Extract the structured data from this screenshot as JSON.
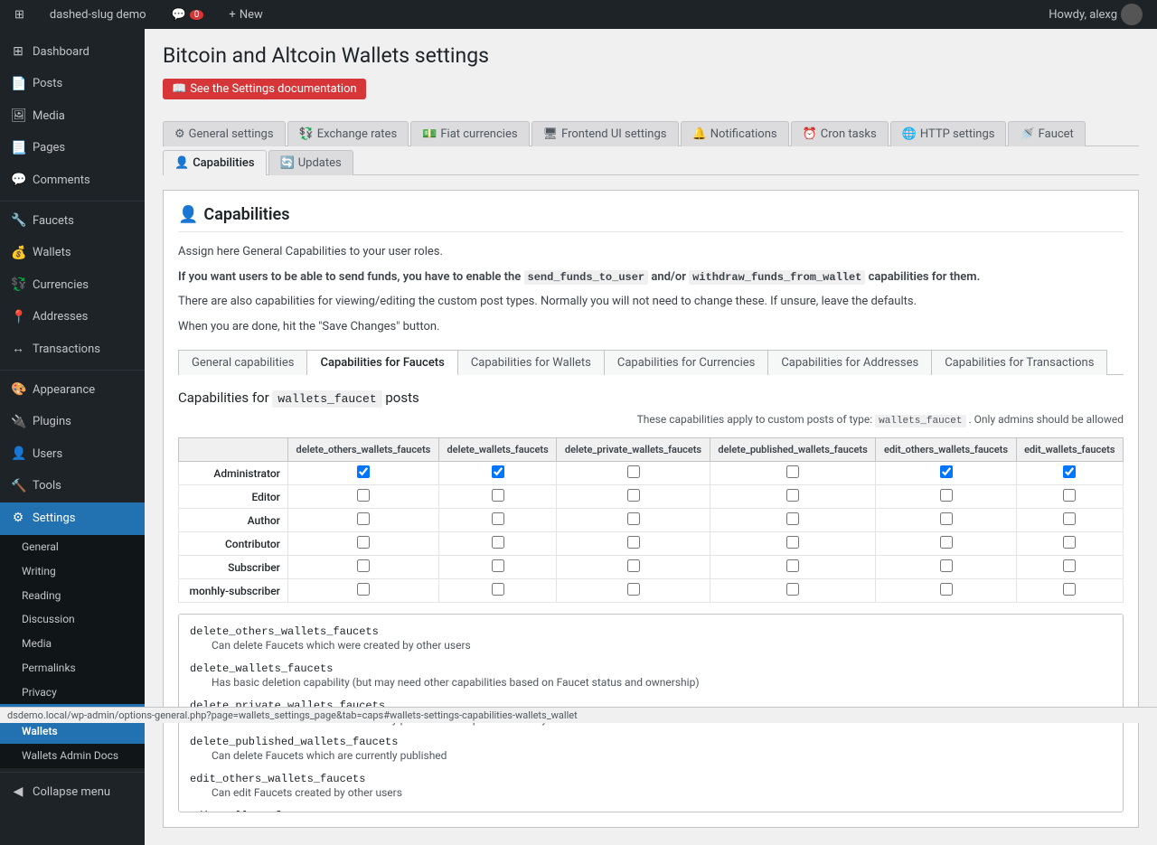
{
  "adminbar": {
    "logo": "⊞",
    "site_name": "dashed-slug demo",
    "comments_label": "Comments",
    "comments_count": "0",
    "new_label": "New",
    "howdy": "Howdy, alexg"
  },
  "page": {
    "title": "Bitcoin and Altcoin Wallets settings",
    "doc_btn": "See the Settings documentation"
  },
  "sidebar": {
    "items": [
      {
        "id": "dashboard",
        "icon": "⊞",
        "label": "Dashboard"
      },
      {
        "id": "posts",
        "icon": "📄",
        "label": "Posts"
      },
      {
        "id": "media",
        "icon": "🖼",
        "label": "Media"
      },
      {
        "id": "pages",
        "icon": "📃",
        "label": "Pages"
      },
      {
        "id": "comments",
        "icon": "💬",
        "label": "Comments"
      },
      {
        "id": "faucets",
        "icon": "🔧",
        "label": "Faucets"
      },
      {
        "id": "wallets",
        "icon": "💰",
        "label": "Wallets"
      },
      {
        "id": "currencies",
        "icon": "💱",
        "label": "Currencies"
      },
      {
        "id": "addresses",
        "icon": "📍",
        "label": "Addresses"
      },
      {
        "id": "transactions",
        "icon": "↔",
        "label": "Transactions"
      },
      {
        "id": "appearance",
        "icon": "🎨",
        "label": "Appearance"
      },
      {
        "id": "plugins",
        "icon": "🔌",
        "label": "Plugins"
      },
      {
        "id": "users",
        "icon": "👤",
        "label": "Users"
      },
      {
        "id": "tools",
        "icon": "🔨",
        "label": "Tools"
      },
      {
        "id": "settings",
        "icon": "⚙",
        "label": "Settings",
        "active": true
      }
    ],
    "submenu": [
      {
        "id": "general",
        "label": "General"
      },
      {
        "id": "writing",
        "label": "Writing"
      },
      {
        "id": "reading",
        "label": "Reading"
      },
      {
        "id": "discussion",
        "label": "Discussion"
      },
      {
        "id": "media",
        "label": "Media"
      },
      {
        "id": "permalinks",
        "label": "Permalinks"
      },
      {
        "id": "privacy",
        "label": "Privacy"
      },
      {
        "id": "bitcoin-altcoin",
        "label": "Bitcoin & Altcoin Wallets",
        "active": true
      },
      {
        "id": "wallets-admin-docs",
        "label": "Wallets Admin Docs"
      }
    ],
    "collapse": "Collapse menu"
  },
  "main_tabs": [
    {
      "id": "general-settings",
      "icon": "⚙",
      "label": "General settings"
    },
    {
      "id": "exchange-rates",
      "icon": "💱",
      "label": "Exchange rates",
      "active": false
    },
    {
      "id": "fiat-currencies",
      "icon": "💵",
      "label": "Fiat currencies"
    },
    {
      "id": "frontend-ui",
      "icon": "🖥",
      "label": "Frontend UI settings"
    },
    {
      "id": "notifications",
      "icon": "🔔",
      "label": "Notifications"
    },
    {
      "id": "cron-tasks",
      "icon": "⏰",
      "label": "Cron tasks"
    },
    {
      "id": "http-settings",
      "icon": "🌐",
      "label": "HTTP settings"
    },
    {
      "id": "faucet",
      "icon": "🚿",
      "label": "Faucet"
    }
  ],
  "second_tabs": [
    {
      "id": "capabilities",
      "label": "Capabilities",
      "icon": "👤",
      "active": true
    },
    {
      "id": "updates",
      "label": "Updates",
      "icon": "🔄"
    }
  ],
  "section": {
    "title": "Capabilities",
    "icon": "👤",
    "description1": "Assign here General Capabilities to your user roles.",
    "description2_pre": "If you want users to be able to send funds, you have to enable the ",
    "description2_code1": "send_funds_to_user",
    "description2_mid": " and/or ",
    "description2_code2": "withdraw_funds_from_wallet",
    "description2_post": " capabilities for them.",
    "description3": "There are also capabilities for viewing/editing the custom post types. Normally you will not need to change these. If unsure, leave the defaults.",
    "description4": "When you are done, hit the \"Save Changes\" button."
  },
  "inner_tabs": [
    {
      "id": "general-caps",
      "label": "General capabilities"
    },
    {
      "id": "caps-faucets",
      "label": "Capabilities for Faucets",
      "active": true
    },
    {
      "id": "caps-wallets",
      "label": "Capabilities for Wallets"
    },
    {
      "id": "caps-currencies",
      "label": "Capabilities for Currencies"
    },
    {
      "id": "caps-addresses",
      "label": "Capabilities for Addresses"
    },
    {
      "id": "caps-transactions",
      "label": "Capabilities for Transactions"
    }
  ],
  "caps_for": {
    "label": "Capabilities for",
    "post_type": "wallets_faucet",
    "posts_label": "posts",
    "note_pre": "These capabilities apply to custom posts of type:",
    "note_code": "wallets_faucet",
    "note_post": ". Only admins should be allowed"
  },
  "table": {
    "columns": [
      "delete_others_wallets_faucets",
      "delete_wallets_faucets",
      "delete_private_wallets_faucets",
      "delete_published_wallets_faucets",
      "edit_others_wallets_faucets",
      "edit_wallets_faucets"
    ],
    "roles": [
      {
        "name": "Administrator",
        "checks": [
          true,
          true,
          false,
          false,
          true,
          true
        ]
      },
      {
        "name": "Editor",
        "checks": [
          false,
          false,
          false,
          false,
          false,
          false
        ]
      },
      {
        "name": "Author",
        "checks": [
          false,
          false,
          false,
          false,
          false,
          false
        ]
      },
      {
        "name": "Contributor",
        "checks": [
          false,
          false,
          false,
          false,
          false,
          false
        ]
      },
      {
        "name": "Subscriber",
        "checks": [
          false,
          false,
          false,
          false,
          false,
          false
        ]
      },
      {
        "name": "monhly-subscriber",
        "checks": [
          false,
          false,
          false,
          false,
          false,
          false
        ]
      }
    ]
  },
  "descriptions": [
    {
      "name": "delete_others_wallets_faucets",
      "desc": "Can delete Faucets which were created by other users"
    },
    {
      "name": "delete_wallets_faucets",
      "desc": "Has basic deletion capability (but may need other capabilities based on Faucet status and ownership)"
    },
    {
      "name": "delete_private_wallets_faucets",
      "desc": "Can delete Faucets which are currently published with private visibility"
    },
    {
      "name": "delete_published_wallets_faucets",
      "desc": "Can delete Faucets which are currently published"
    },
    {
      "name": "edit_others_wallets_faucets",
      "desc": "Can edit Faucets created by other users"
    },
    {
      "name": "edit_wallets_faucets",
      "desc": ""
    }
  ],
  "statusbar": {
    "url": "dsdemo.local/wp-admin/options-general.php?page=wallets_settings_page&tab=caps#wallets-settings-capabilities-wallets_wallet"
  }
}
